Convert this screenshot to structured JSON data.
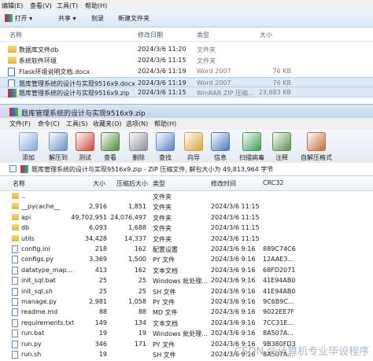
{
  "explorer": {
    "menu": [
      "编辑(E)",
      "查看(V)",
      "工具(T)",
      "帮助(H)"
    ],
    "toolbar": {
      "open": "打开",
      "share": "共享",
      "burn": "刻录",
      "new_folder": "新建文件夹"
    },
    "columns": {
      "name": "名称",
      "modified": "修改日期",
      "type": "类型",
      "size": "大小"
    },
    "rows": [
      {
        "name": "数据库文件db",
        "modified": "2024/3/6 11:20",
        "type": "文件夹",
        "size": "",
        "icon": "folder-icon"
      },
      {
        "name": "系统软件环境",
        "modified": "2024/3/6 11:15",
        "type": "文件夹",
        "size": "",
        "icon": "folder-icon"
      },
      {
        "name": "Flask环境说明文档.docx",
        "modified": "2024/3/6 11:19",
        "type": "Word 2007",
        "size": "76 KB",
        "icon": "word-icon"
      },
      {
        "name": "题库管理系统的设计与实现9516x9.docx",
        "modified": "2024/3/6 11:19",
        "type": "Word 2007",
        "size": "76 KB",
        "icon": "word-icon"
      },
      {
        "name": "题库管理系统的设计与实现9516x9.zip",
        "modified": "2024/3/6 11:15",
        "type": "WinRAR ZIP 压缩...",
        "size": "23,683 KB",
        "icon": "zip-icon"
      }
    ]
  },
  "winrar": {
    "title": "题库管理系统的设计与实现9516x9.zip",
    "menu": [
      "文件(F)",
      "命令(C)",
      "工具(S)",
      "收藏夹(O)",
      "选项(N)",
      "帮助(H)"
    ],
    "tools": [
      {
        "label": "添加",
        "icon": "add-icon",
        "color": "#7ea7d8"
      },
      {
        "label": "解压到",
        "icon": "extract-to-icon",
        "color": "#6b8fc7"
      },
      {
        "label": "测试",
        "icon": "test-icon",
        "color": "#c94a3a"
      },
      {
        "label": "查看",
        "icon": "view-icon",
        "color": "#4a8a3a"
      },
      {
        "label": "删除",
        "icon": "delete-icon",
        "color": "#8a8f98"
      },
      {
        "label": "查找",
        "icon": "find-icon",
        "color": "#5a83c2"
      },
      {
        "label": "向导",
        "icon": "wizard-icon",
        "color": "#d9a23b"
      },
      {
        "label": "信息",
        "icon": "info-icon",
        "color": "#4a77c0"
      },
      {
        "label": "扫描病毒",
        "icon": "scan-icon",
        "color": "#3e9a52"
      },
      {
        "label": "注释",
        "icon": "comment-icon",
        "color": "#5b8f4f"
      },
      {
        "label": "自解压格式",
        "icon": "sfx-icon",
        "color": "#c76b3a"
      }
    ],
    "path": "题库管理系统的设计与实现9516x9.zip - ZIP 压缩文件, 解包大小为 49,813,964 字节",
    "columns": {
      "name": "名称",
      "size": "大小",
      "packed": "压缩后大小",
      "type": "类型",
      "modified": "修改时间",
      "crc": "CRC32"
    },
    "rows": [
      {
        "name": "..",
        "size": "",
        "packed": "",
        "type": "文件夹",
        "modified": "",
        "crc": "",
        "kind": "folder"
      },
      {
        "name": "__pycache__",
        "size": "2,916",
        "packed": "1,851",
        "type": "文件夹",
        "modified": "2024/3/6 11:15",
        "crc": "",
        "kind": "folder"
      },
      {
        "name": "api",
        "size": "49,702,951",
        "packed": "24,076,497",
        "type": "文件夹",
        "modified": "2024/3/6 11:15",
        "crc": "",
        "kind": "folder"
      },
      {
        "name": "db",
        "size": "6,093",
        "packed": "1,688",
        "type": "文件夹",
        "modified": "2024/3/6 11:15",
        "crc": "",
        "kind": "folder"
      },
      {
        "name": "utils",
        "size": "34,428",
        "packed": "14,337",
        "type": "文件夹",
        "modified": "2024/3/6 11:15",
        "crc": "",
        "kind": "folder"
      },
      {
        "name": "config.ini",
        "size": "218",
        "packed": "162",
        "type": "配置设置",
        "modified": "2024/3/6 9:16",
        "crc": "889C74C6",
        "kind": "file"
      },
      {
        "name": "configs.py",
        "size": "3,369",
        "packed": "1,500",
        "type": "PY 文件",
        "modified": "2024/3/6 9:16",
        "crc": "12AAE3...",
        "kind": "file"
      },
      {
        "name": "datatype_map...",
        "size": "413",
        "packed": "162",
        "type": "文本文档",
        "modified": "2024/3/6 9:16",
        "crc": "68FD2071",
        "kind": "file"
      },
      {
        "name": "init_sql.bat",
        "size": "25",
        "packed": "25",
        "type": "Windows 批处理...",
        "modified": "2024/3/6 9:16",
        "crc": "41E94AB0",
        "kind": "file"
      },
      {
        "name": "init_sql.sh",
        "size": "25",
        "packed": "25",
        "type": "SH 文件",
        "modified": "2024/3/6 9:16",
        "crc": "41E94AB0",
        "kind": "file"
      },
      {
        "name": "manage.py",
        "size": "2,981",
        "packed": "1,058",
        "type": "PY 文件",
        "modified": "2024/3/6 9:16",
        "crc": "9C6B9C...",
        "kind": "file"
      },
      {
        "name": "readme.md",
        "size": "88",
        "packed": "88",
        "type": "MD 文件",
        "modified": "2024/3/6 9:16",
        "crc": "9022EE7F",
        "kind": "file"
      },
      {
        "name": "requirements.txt",
        "size": "149",
        "packed": "134",
        "type": "文本文档",
        "modified": "2024/3/6 9:16",
        "crc": "7CC31E...",
        "kind": "file"
      },
      {
        "name": "run.bat",
        "size": "19",
        "packed": "19",
        "type": "Windows 批处理...",
        "modified": "2024/3/6 9:16",
        "crc": "8A507A...",
        "kind": "file"
      },
      {
        "name": "run.py",
        "size": "346",
        "packed": "171",
        "type": "PY 文件",
        "modified": "2024/3/6 9:16",
        "crc": "9B380FD3",
        "kind": "file"
      },
      {
        "name": "run.sh",
        "size": "19",
        "packed": "",
        "type": "SH 文件",
        "modified": "2024/3/6 9:16",
        "crc": "8A507A...",
        "kind": "file"
      }
    ]
  },
  "watermark": "CSDN @计算机专业毕设程序"
}
